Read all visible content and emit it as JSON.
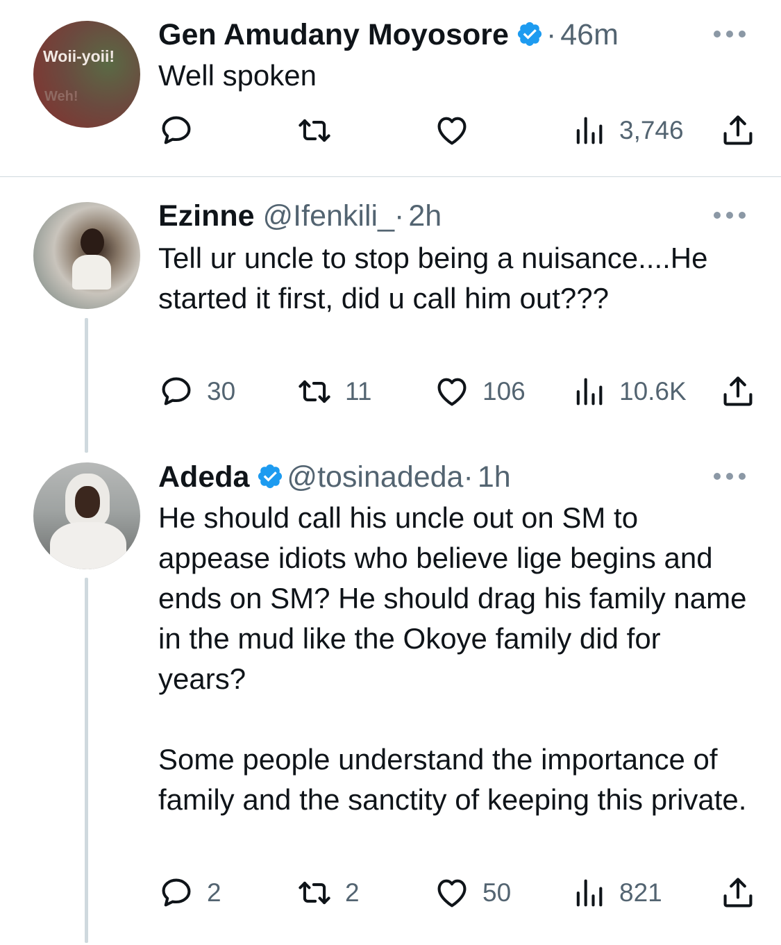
{
  "tweets": [
    {
      "name": "Gen Amudany Moyosore",
      "verified": true,
      "handle": "",
      "time": "46m",
      "body": [
        "Well spoken"
      ],
      "avatar_text": [
        "Woii-yoii!",
        "Weh!"
      ],
      "replies": "",
      "retweets": "",
      "likes": "",
      "views": "3,746"
    },
    {
      "name": "Ezinne",
      "verified": false,
      "handle": "@Ifenkili_",
      "time": "2h",
      "body": [
        "Tell ur uncle to stop being a nuisance....He started it first, did u call him out???"
      ],
      "replies": "30",
      "retweets": "11",
      "likes": "106",
      "views": "10.6K"
    },
    {
      "name": "Adeda",
      "verified": true,
      "handle": "@tosinadeda",
      "time": "1h",
      "body": [
        "He should call his uncle out on SM to appease idiots who believe lige begins and ends on SM? He should drag his family name in the mud like the Okoye family did for years?",
        "Some people understand the importance of family and the sanctity of keeping this private."
      ],
      "replies": "2",
      "retweets": "2",
      "likes": "50",
      "views": "821"
    }
  ],
  "separator": "·",
  "icons": {
    "reply": "reply-icon",
    "retweet": "retweet-icon",
    "like": "heart-icon",
    "views": "views-icon",
    "share": "share-icon",
    "more": "more-icon",
    "verified": "verified-badge-icon"
  },
  "colors": {
    "text": "#0f1419",
    "secondary": "#536471",
    "verified": "#1d9bf0",
    "divider": "#cfd9de"
  }
}
